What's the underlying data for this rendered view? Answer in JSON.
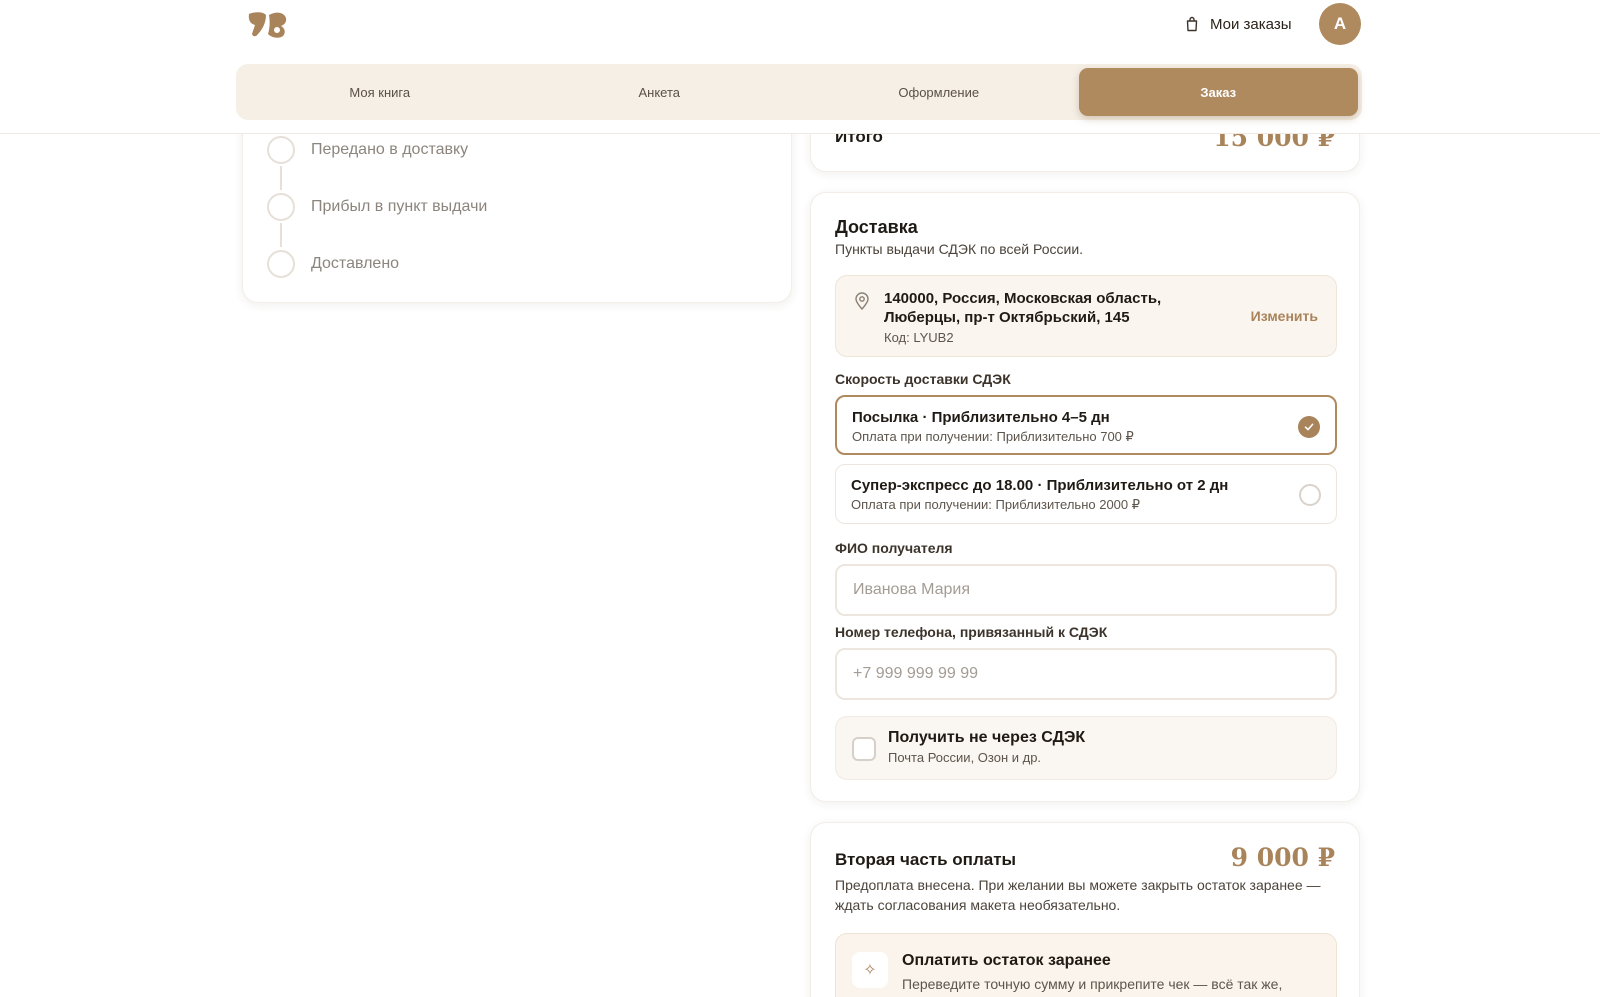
{
  "header": {
    "orders_label": "Мои заказы",
    "avatar_initial": "А",
    "tabs": [
      {
        "label": "Моя книга",
        "active": false
      },
      {
        "label": "Анкета",
        "active": false
      },
      {
        "label": "Оформление",
        "active": false
      },
      {
        "label": "Заказ",
        "active": true
      }
    ]
  },
  "timeline": {
    "steps": [
      {
        "label": "Передано в доставку"
      },
      {
        "label": "Прибыл в пункт выдачи"
      },
      {
        "label": "Доставлено"
      }
    ]
  },
  "total": {
    "label": "Итого",
    "value": "15 000 ₽"
  },
  "delivery": {
    "title": "Доставка",
    "subtitle": "Пункты выдачи СДЭК по всей России.",
    "address": {
      "line1": "140000, Россия, Московская область,",
      "line2": "Люберцы, пр-т Октябрьский, 145",
      "code": "Код: LYUB2",
      "change_label": "Изменить"
    },
    "speed_label": "Скорость доставки СДЭК",
    "options": [
      {
        "title": "Посылка · Приблизительно 4–5 дн",
        "subtitle": "Оплата при получении: Приблизительно 700 ₽",
        "selected": true
      },
      {
        "title": "Супер-экспресс до 18.00 · Приблизительно от 2 дн",
        "subtitle": "Оплата при получении: Приблизительно 2000 ₽",
        "selected": false
      }
    ],
    "name_label": "ФИО получателя",
    "name_placeholder": "Иванова Мария",
    "phone_label": "Номер телефона, привязанный к СДЭК",
    "phone_placeholder": "+7 999 999 99 99",
    "alt_delivery": {
      "title": "Получить не через СДЭК",
      "subtitle": "Почта России, Озон и др.",
      "checked": false
    }
  },
  "payment": {
    "title": "Вторая часть оплаты",
    "amount": "9 000 ₽",
    "description": "Предоплата внесена. При желании вы можете закрыть остаток заранее — ждать согласования макета необязательно.",
    "prepay": {
      "title": "Оплатить остаток заранее",
      "subtitle": "Переведите точную сумму и прикрепите чек — всё так же,"
    }
  },
  "colors": {
    "accent": "#b08a5f",
    "accent_text": "#a9845b",
    "tab_bg": "#f6efe6"
  },
  "icons": {
    "logo": "brand-logo",
    "orders": "shopping-bag-icon",
    "address": "map-pin-icon",
    "selected": "check-icon",
    "prepay": "sparkle-icon"
  }
}
